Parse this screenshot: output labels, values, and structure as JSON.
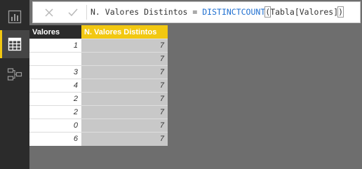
{
  "formula_bar": {
    "prefix": "N. Valores Distintos = ",
    "function": "DISTINCTCOUNT",
    "open_paren": "(",
    "argument": "Tabla[Valores]",
    "close_paren": ")"
  },
  "left_nav": {
    "items": [
      "report-view",
      "data-view",
      "relationships-view"
    ],
    "active": "data-view"
  },
  "colors": {
    "accent": "#f2c811",
    "nav_bg": "#2b2b2b",
    "canvas": "#6e6e6e"
  },
  "table": {
    "columns": [
      "Valores",
      "N. Valores Distintos"
    ],
    "rows": [
      [
        "1",
        "7"
      ],
      [
        "",
        "7"
      ],
      [
        "3",
        "7"
      ],
      [
        "4",
        "7"
      ],
      [
        "2",
        "7"
      ],
      [
        "2",
        "7"
      ],
      [
        "0",
        "7"
      ],
      [
        "6",
        "7"
      ]
    ]
  }
}
